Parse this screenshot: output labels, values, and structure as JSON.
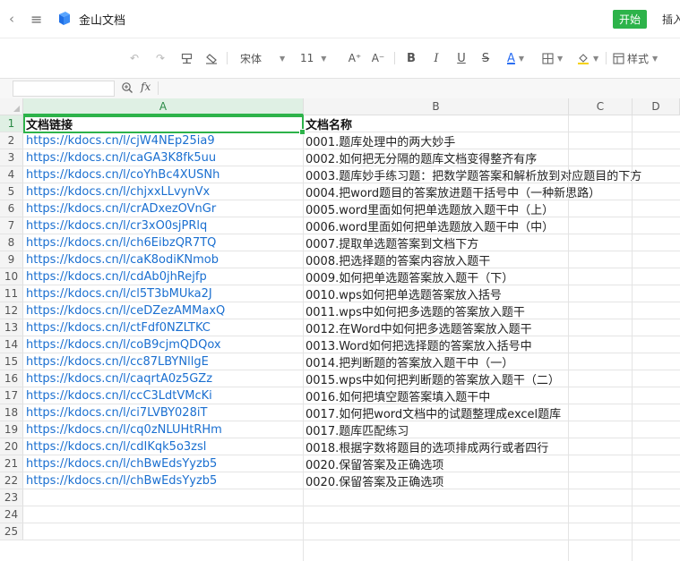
{
  "titlebar": {
    "app_name": "金山文档",
    "tab_start": "开始",
    "tab_insert": "插入"
  },
  "toolbar": {
    "font_name": "宋体",
    "font_size": "11",
    "increase_font": "A⁺",
    "decrease_font": "A⁻",
    "bold": "B",
    "italic": "I",
    "underline": "U",
    "strike": "S",
    "font_color": "A",
    "style_label": "样式"
  },
  "formula_bar": {
    "name_box_value": "",
    "fx_label": "fx"
  },
  "sheet": {
    "columns": [
      "A",
      "B",
      "C",
      "D"
    ],
    "rows": [
      {
        "num": "1",
        "a": "文档链接",
        "b": "文档名称"
      },
      {
        "num": "2",
        "a": "https://kdocs.cn/l/cjW4NEp25ia9",
        "b": "0001.题库处理中的两大妙手"
      },
      {
        "num": "3",
        "a": "https://kdocs.cn/l/caGA3K8fk5uu",
        "b": "0002.如何把无分隔的题库文档变得整齐有序"
      },
      {
        "num": "4",
        "a": "https://kdocs.cn/l/coYhBc4XUSNh",
        "b": "0003.题库妙手练习题：把数学题答案和解析放到对应题目的下方"
      },
      {
        "num": "5",
        "a": "https://kdocs.cn/l/chjxxLLvynVx",
        "b": "0004.把word题目的答案放进题干括号中（一种新思路）"
      },
      {
        "num": "6",
        "a": "https://kdocs.cn/l/crADxezOVnGr",
        "b": "0005.word里面如何把单选题放入题干中（上）"
      },
      {
        "num": "7",
        "a": "https://kdocs.cn/l/cr3xO0sjPRlq",
        "b": "0006.word里面如何把单选题放入题干中（中）"
      },
      {
        "num": "8",
        "a": "https://kdocs.cn/l/ch6EibzQR7TQ",
        "b": "0007.提取单选题答案到文档下方"
      },
      {
        "num": "9",
        "a": "https://kdocs.cn/l/caK8odiKNmob",
        "b": "0008.把选择题的答案内容放入题干"
      },
      {
        "num": "10",
        "a": "https://kdocs.cn/l/cdAb0jhRejfp",
        "b": "0009.如何把单选题答案放入题干（下）"
      },
      {
        "num": "11",
        "a": "https://kdocs.cn/l/cl5T3bMUka2J",
        "b": "0010.wps如何把单选题答案放入括号"
      },
      {
        "num": "12",
        "a": "https://kdocs.cn/l/ceDZezAMMaxQ",
        "b": "0011.wps中如何把多选题的答案放入题干"
      },
      {
        "num": "13",
        "a": "https://kdocs.cn/l/ctFdf0NZLTKC",
        "b": "0012.在Word中如何把多选题答案放入题干"
      },
      {
        "num": "14",
        "a": "https://kdocs.cn/l/coB9cjmQDQox",
        "b": "0013.Word如何把选择题的答案放入括号中"
      },
      {
        "num": "15",
        "a": "https://kdocs.cn/l/cc87LBYNllgE",
        "b": "0014.把判断题的答案放入题干中（一）"
      },
      {
        "num": "16",
        "a": "https://kdocs.cn/l/caqrtA0z5GZz",
        "b": "0015.wps中如何把判断题的答案放入题干（二）"
      },
      {
        "num": "17",
        "a": "https://kdocs.cn/l/ccC3LdtVMcKi",
        "b": "0016.如何把填空题答案填入题干中"
      },
      {
        "num": "18",
        "a": "https://kdocs.cn/l/ci7LVBY028iT",
        "b": "0017.如何把word文档中的试题整理成excel题库"
      },
      {
        "num": "19",
        "a": "https://kdocs.cn/l/cq0zNLUHtRHm",
        "b": "0017.题库匹配练习"
      },
      {
        "num": "20",
        "a": "https://kdocs.cn/l/cdIKqk5o3zsl",
        "b": "0018.根据字数将题目的选项排成两行或者四行"
      },
      {
        "num": "21",
        "a": "https://kdocs.cn/l/chBwEdsYyzb5",
        "b": "0020.保留答案及正确选项"
      },
      {
        "num": "22",
        "a": "https://kdocs.cn/l/chBwEdsYyzb5",
        "b": "0020.保留答案及正确选项"
      },
      {
        "num": "23",
        "a": "",
        "b": ""
      },
      {
        "num": "24",
        "a": "",
        "b": ""
      },
      {
        "num": "25",
        "a": "",
        "b": ""
      }
    ]
  }
}
